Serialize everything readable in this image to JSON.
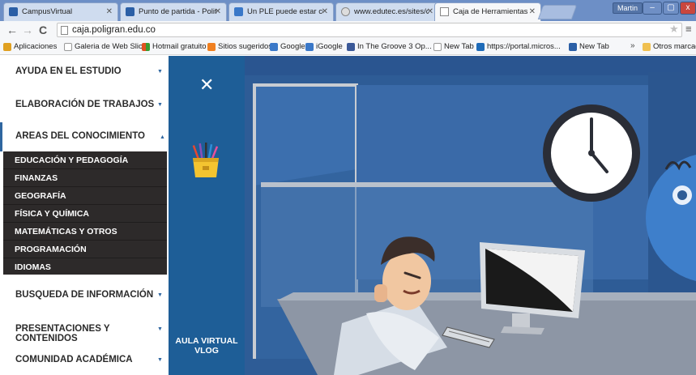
{
  "browser": {
    "tabs": [
      {
        "title": "CampusVirtual",
        "icon_color": "#2b5fa6"
      },
      {
        "title": "Punto de partida - Politec",
        "icon_color": "#2b5fa6"
      },
      {
        "title": "Un PLE puede estar comp",
        "icon_color": "#3a78c8"
      },
      {
        "title": "www.edutec.es/sites/defa",
        "icon_color": "#8a8a8a"
      },
      {
        "title": "Caja de Herramientas - Po",
        "icon_color": "#ffffff"
      }
    ],
    "user_label": "Martin",
    "window_controls": {
      "minimize": "–",
      "maximize": "▢",
      "close": "x"
    },
    "url": "caja.poligran.edu.co",
    "bookmarks": [
      {
        "label": "Aplicaciones",
        "icon_color": "#e0a020"
      },
      {
        "label": "Galeria de Web Slice",
        "icon_color": "#ffffff"
      },
      {
        "label": "Hotmail gratuito",
        "icon_color": "#e05020"
      },
      {
        "label": "Sitios sugeridos",
        "icon_color": "#f08020"
      },
      {
        "label": "Google",
        "icon_color": "#3a78c8"
      },
      {
        "label": "iGoogle",
        "icon_color": "#3a78c8"
      },
      {
        "label": "In The Groove 3 Op...",
        "icon_color": "#3b5998"
      },
      {
        "label": "New Tab",
        "icon_color": "#ffffff"
      },
      {
        "label": "https://portal.micros...",
        "icon_color": "#1e6bb8"
      },
      {
        "label": "New Tab",
        "icon_color": "#2b5fa6"
      }
    ],
    "bookmarks_more": "»",
    "other_bookmarks": "Otros marcadores"
  },
  "sidenav": {
    "items": [
      {
        "label": "AYUDA EN EL ESTUDIO",
        "open": false
      },
      {
        "label": "ELABORACIÓN DE TRABAJOS",
        "open": false
      },
      {
        "label": "AREAS DEL CONOCIMIENTO",
        "open": true
      },
      {
        "label": "BUSQUEDA DE INFORMACIÓN",
        "open": false
      },
      {
        "label": "PRESENTACIONES Y CONTENIDOS",
        "open": false
      },
      {
        "label": "COMUNIDAD ACADÉMICA",
        "open": false
      }
    ],
    "submenu": [
      "EDUCACIÓN Y PEDAGOGÍA",
      "FINANZAS",
      "GEOGRAFÍA",
      "FÍSICA Y QUÍMICA",
      "MATEMÁTICAS Y OTROS",
      "PROGRAMACIÓN",
      "IDIOMAS"
    ]
  },
  "panel": {
    "close_glyph": "✕",
    "bottom_label_line1": "AULA VIRTUAL",
    "bottom_label_line2": "VLOG"
  },
  "colors": {
    "panel_blue": "#1e5e97",
    "submenu_bg": "#2d2a2a",
    "accent": "#2f66a0",
    "scene_wall": "#2f5f9a",
    "tab_strip": "#6d8fc6"
  }
}
